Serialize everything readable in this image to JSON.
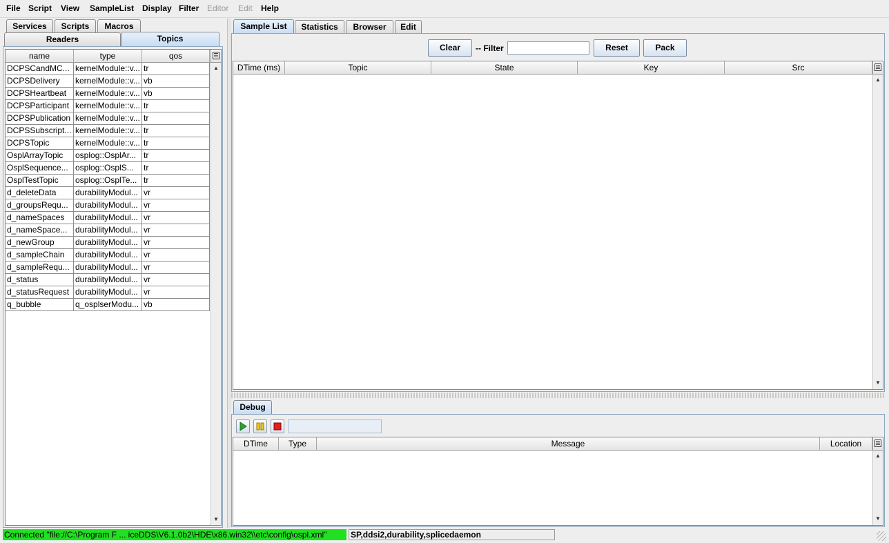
{
  "menu": [
    {
      "label": "File",
      "enabled": true
    },
    {
      "label": "Script",
      "enabled": true
    },
    {
      "label": "View",
      "enabled": true
    },
    {
      "label": "SampleList",
      "enabled": true
    },
    {
      "label": "Display",
      "enabled": true
    },
    {
      "label": "Filter",
      "enabled": true
    },
    {
      "label": "Editor",
      "enabled": false
    },
    {
      "label": "Edit",
      "enabled": false
    },
    {
      "label": "Help",
      "enabled": true
    }
  ],
  "left_tabs_top": [
    "Services",
    "Scripts",
    "Macros"
  ],
  "left_tabs_bottom": [
    "Readers",
    "Topics"
  ],
  "left_tabs_bottom_selected": "Topics",
  "topics_table": {
    "columns": [
      "name",
      "type",
      "qos"
    ],
    "rows": [
      [
        "DCPSCandMC...",
        "kernelModule::v...",
        "tr"
      ],
      [
        "DCPSDelivery",
        "kernelModule::v...",
        "vb"
      ],
      [
        "DCPSHeartbeat",
        "kernelModule::v...",
        "vb"
      ],
      [
        "DCPSParticipant",
        "kernelModule::v...",
        "tr"
      ],
      [
        "DCPSPublication",
        "kernelModule::v...",
        "tr"
      ],
      [
        "DCPSSubscript...",
        "kernelModule::v...",
        "tr"
      ],
      [
        "DCPSTopic",
        "kernelModule::v...",
        "tr"
      ],
      [
        "OsplArrayTopic",
        "osplog::OsplAr...",
        "tr"
      ],
      [
        "OsplSequence...",
        "osplog::OsplS...",
        "tr"
      ],
      [
        "OsplTestTopic",
        "osplog::OsplTe...",
        "tr"
      ],
      [
        "d_deleteData",
        "durabilityModul...",
        "vr"
      ],
      [
        "d_groupsRequ...",
        "durabilityModul...",
        "vr"
      ],
      [
        "d_nameSpaces",
        "durabilityModul...",
        "vr"
      ],
      [
        "d_nameSpace...",
        "durabilityModul...",
        "vr"
      ],
      [
        "d_newGroup",
        "durabilityModul...",
        "vr"
      ],
      [
        "d_sampleChain",
        "durabilityModul...",
        "vr"
      ],
      [
        "d_sampleRequ...",
        "durabilityModul...",
        "vr"
      ],
      [
        "d_status",
        "durabilityModul...",
        "vr"
      ],
      [
        "d_statusRequest",
        "durabilityModul...",
        "vr"
      ],
      [
        "q_bubble",
        "q_osplserModu...",
        "vb"
      ]
    ]
  },
  "right_tabs": [
    "Sample List",
    "Statistics",
    "Browser",
    "Edit"
  ],
  "right_tabs_selected": "Sample List",
  "toolbar": {
    "clear_label": "Clear",
    "filter_label": "-- Filter",
    "filter_value": "",
    "reset_label": "Reset",
    "pack_label": "Pack"
  },
  "sample_table": {
    "columns": [
      "DTime (ms)",
      "Topic",
      "State",
      "Key",
      "Src"
    ]
  },
  "debug": {
    "tab_label": "Debug",
    "columns": [
      "DTime",
      "Type",
      "Message",
      "Location"
    ],
    "progress": ""
  },
  "status": {
    "connection": "Connected \"file://C:\\Program F ... iceDDS\\V6.1.0b2\\HDE\\x86.win32\\\\etc\\config\\ospl.xml\"",
    "services": "SP,ddsi2,durability,splicedaemon"
  },
  "colors": {
    "connected_bg": "#21e021",
    "selected_tab": "#c7dcf3"
  },
  "icons": [
    "play-icon",
    "pause-icon",
    "stop-icon",
    "column-chooser-icon",
    "arrow-up-icon",
    "arrow-down-icon"
  ]
}
